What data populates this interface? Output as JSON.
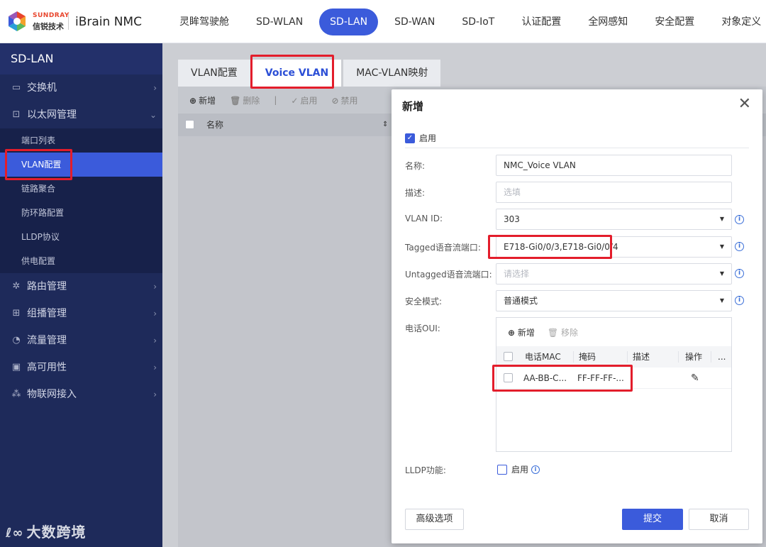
{
  "brand": {
    "company_en": "SUNDRAY",
    "company_cn": "信锐技术",
    "product": "iBrain NMC"
  },
  "topnav": [
    "灵眸驾驶舱",
    "SD-WLAN",
    "SD-LAN",
    "SD-WAN",
    "SD-IoT",
    "认证配置",
    "全网感知",
    "安全配置",
    "对象定义"
  ],
  "topnav_active": "SD-LAN",
  "sidebar": {
    "title": "SD-LAN",
    "items": [
      {
        "label": "交换机",
        "icon": "switch-icon"
      },
      {
        "label": "以太网管理",
        "icon": "ethernet-icon"
      },
      {
        "label": "路由管理",
        "icon": "route-icon"
      },
      {
        "label": "组播管理",
        "icon": "multicast-icon"
      },
      {
        "label": "流量管理",
        "icon": "traffic-icon"
      },
      {
        "label": "高可用性",
        "icon": "ha-icon"
      },
      {
        "label": "物联网接入",
        "icon": "iot-icon"
      }
    ],
    "subitems": [
      "端口列表",
      "VLAN配置",
      "链路聚合",
      "防环路配置",
      "LLDP协议",
      "供电配置"
    ],
    "subitem_active": "VLAN配置"
  },
  "watermark": "大数跨境",
  "tabs": [
    "VLAN配置",
    "Voice VLAN",
    "MAC-VLAN映射"
  ],
  "tab_active": "Voice VLAN",
  "toolbar": {
    "add": "新增",
    "delete": "删除",
    "enable": "启用",
    "disable": "禁用"
  },
  "grid": {
    "col_name": "名称"
  },
  "modal": {
    "title": "新增",
    "enable_label": "启用",
    "fields": {
      "name": {
        "label": "名称:",
        "value": "NMC_Voice VLAN"
      },
      "desc": {
        "label": "描述:",
        "placeholder": "选填"
      },
      "vlan_id": {
        "label": "VLAN ID:",
        "value": "303"
      },
      "tagged": {
        "label": "Tagged语音流端口:",
        "value": "E718-Gi0/0/3,E718-Gi0/0/4"
      },
      "untagged": {
        "label": "Untagged语音流端口:",
        "placeholder": "请选择"
      },
      "security": {
        "label": "安全模式:",
        "value": "普通模式"
      }
    },
    "oui": {
      "label": "电话OUI:",
      "add": "新增",
      "remove": "移除",
      "columns": [
        "电话MAC",
        "掩码",
        "描述",
        "操作",
        "..."
      ],
      "rows": [
        {
          "mac": "AA-BB-C...",
          "mask": "FF-FF-FF-...",
          "desc": ""
        }
      ]
    },
    "lldp": {
      "label": "LLDP功能:",
      "option": "启用"
    },
    "buttons": {
      "advanced": "高级选项",
      "submit": "提交",
      "cancel": "取消"
    }
  },
  "colors": {
    "accent": "#3b5bdb",
    "sidebar": "#1e2a5a",
    "highlight": "#e31d2b"
  }
}
